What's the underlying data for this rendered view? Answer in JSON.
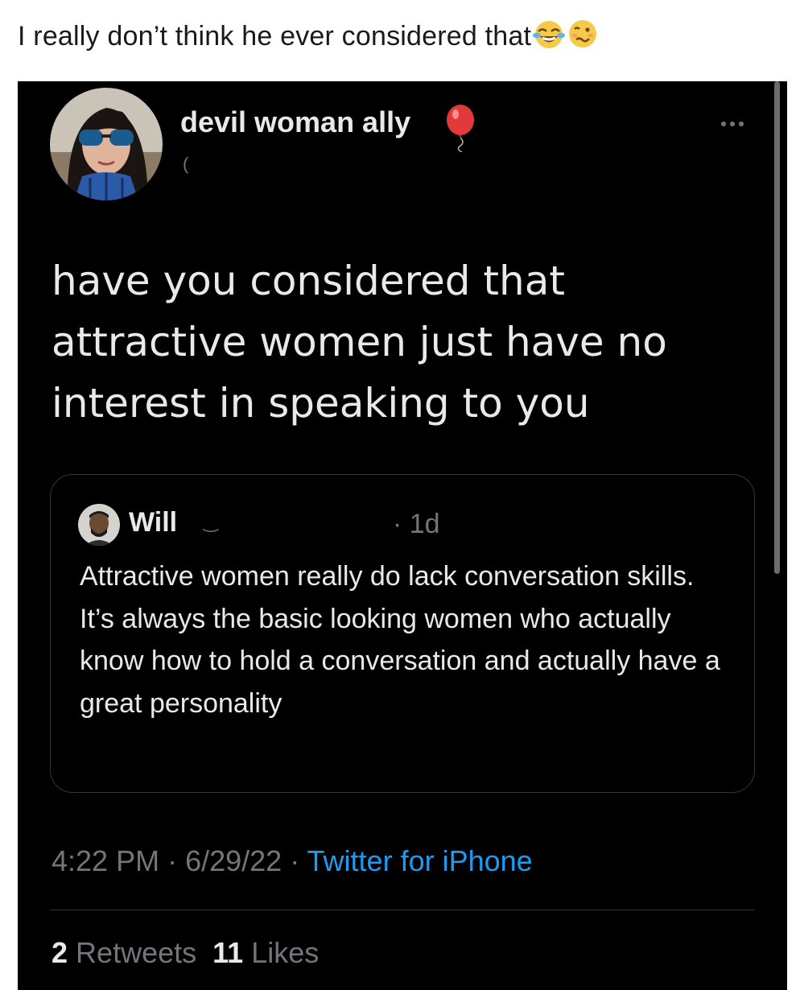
{
  "caption": {
    "text": "I really don’t think he ever considered that",
    "emojis": [
      "tears-of-joy-emoji",
      "woozy-face-emoji"
    ]
  },
  "tweet": {
    "author": {
      "display_name": "devil woman ally",
      "badge_icon": "balloon-icon",
      "handle_fragment": "("
    },
    "menu_icon": "more-icon",
    "text": "have you considered that attractive women just have no interest in speaking to you",
    "quoted": {
      "author_name": "Will",
      "handle_fragment": "‿",
      "time": "· 1d",
      "text": "Attractive women really do lack conversation skills. It’s always the basic looking women who actually know how to hold a conversation and actually have a great personality"
    },
    "meta": {
      "time": "4:22 PM",
      "sep1": " · ",
      "date": "6/29/22",
      "sep2": " · ",
      "source": "Twitter for iPhone"
    },
    "stats": {
      "retweets_count": "2",
      "retweets_label": "Retweets",
      "likes_count": "11",
      "likes_label": "Likes"
    }
  },
  "colors": {
    "background": "#000000",
    "text": "#e7e9ea",
    "secondary": "#71767b",
    "link": "#1d9bf0",
    "border": "#333639"
  }
}
